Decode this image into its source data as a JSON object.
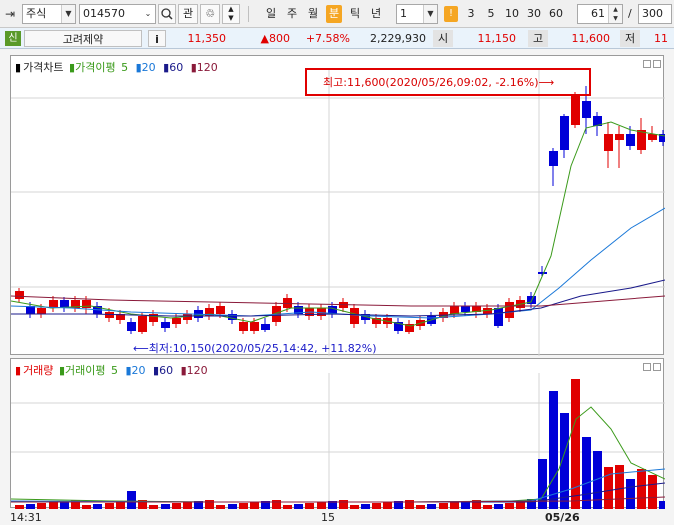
{
  "toolbar": {
    "market_select": "주식",
    "stock_code": "014570",
    "search_icon": "search-icon",
    "watch_label": "관",
    "periods": [
      "일",
      "주",
      "월",
      "분",
      "틱",
      "년"
    ],
    "active_period": "분",
    "interval_value": "1",
    "minute_options": [
      "3",
      "5",
      "10",
      "30",
      "60"
    ],
    "count_value": "61",
    "slash": "/",
    "total_value": "300"
  },
  "quote": {
    "badge": "신",
    "stock_name": "고려제약",
    "info_button": "i",
    "price": "11,350",
    "change": "▲800",
    "change_pct": "+7.58%",
    "volume": "2,229,930",
    "open_label": "시",
    "open_value": "11,150",
    "high_label": "고",
    "high_value": "11,600",
    "low_label": "저",
    "low_value": "11"
  },
  "price_pane": {
    "legend_title": "가격차트",
    "ma_label": "가격이평",
    "ma_periods": [
      "5",
      "20",
      "60",
      "120"
    ],
    "high_annotation": "최고:11,600(2020/05/26,09:02, -2.16%)⟶",
    "low_annotation": "⟵최저:10,150(2020/05/25,14:42, +11.82%)"
  },
  "volume_pane": {
    "legend_title": "거래량",
    "ma_label": "거래이평",
    "ma_periods": [
      "5",
      "20",
      "60",
      "120"
    ]
  },
  "xaxis": {
    "labels": [
      "14:31",
      "15",
      "05/26"
    ]
  },
  "colors": {
    "up": "#e00000",
    "down": "#0000d8",
    "ma5": "#3a9a1a",
    "ma20": "#1a78d8",
    "ma60": "#1a1a8a",
    "ma120": "#8a1a3a"
  }
}
